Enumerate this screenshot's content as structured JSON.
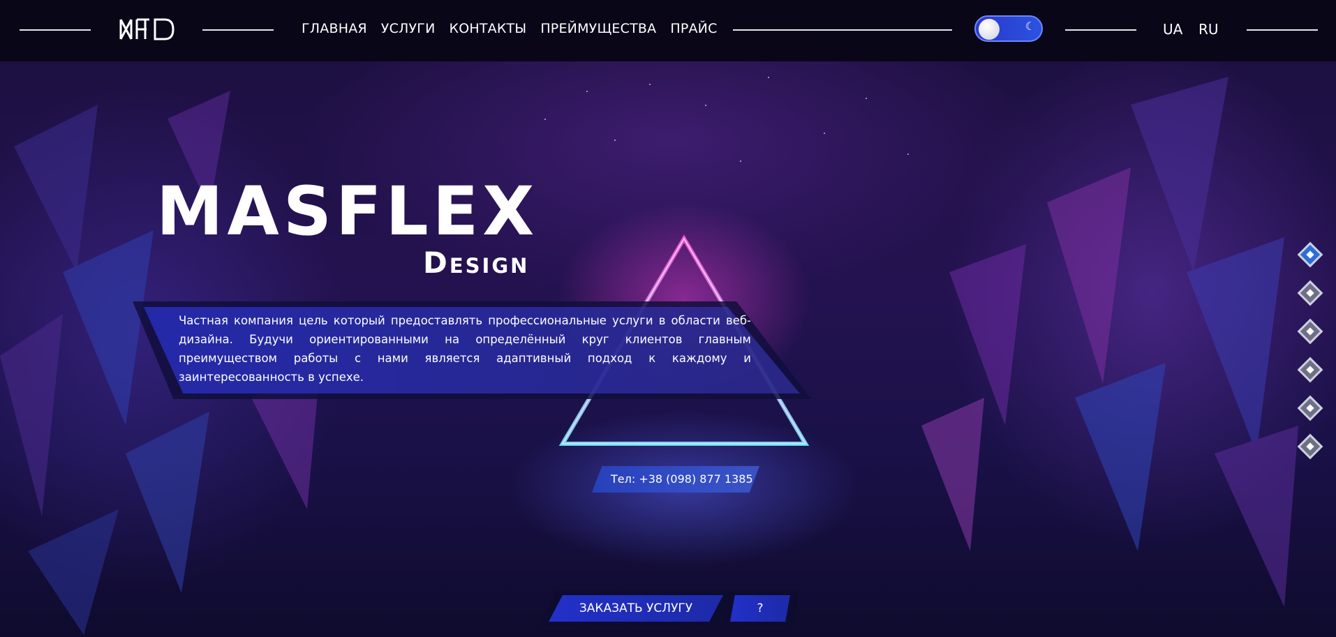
{
  "header": {
    "logo_text": "MFD",
    "nav": [
      {
        "label": "ГЛАВНАЯ"
      },
      {
        "label": "УСЛУГИ"
      },
      {
        "label": "КОНТАКТЫ"
      },
      {
        "label": "ПРЕЙМУЩЕСТВА"
      },
      {
        "label": "ПРАЙС"
      }
    ],
    "theme_toggle": {
      "icon": "moon-icon",
      "state": "dark"
    },
    "languages": [
      {
        "label": "UA"
      },
      {
        "label": "RU"
      }
    ]
  },
  "hero": {
    "title": "MASFLEX",
    "subtitle": "Design",
    "description": "Частная компания цель который предоставлять профессиональные услуги в области веб-дизайна. Будучи ориентированными на определённый круг клиентов главным преимуществом работы с нами является адаптивный подход к каждому и заинтересованность в успехе.",
    "phone": "Тел: +38 (098) 877 1385",
    "order_button": "ЗАКАЗАТЬ УСЛУГУ",
    "help_button": "?"
  },
  "side_nav": {
    "count": 6,
    "active_index": 0
  },
  "colors": {
    "accent_blue": "#2230c8",
    "header_bg": "#08051a",
    "neon_pink": "#ff4fd0",
    "neon_cyan": "#6ef0ff"
  }
}
